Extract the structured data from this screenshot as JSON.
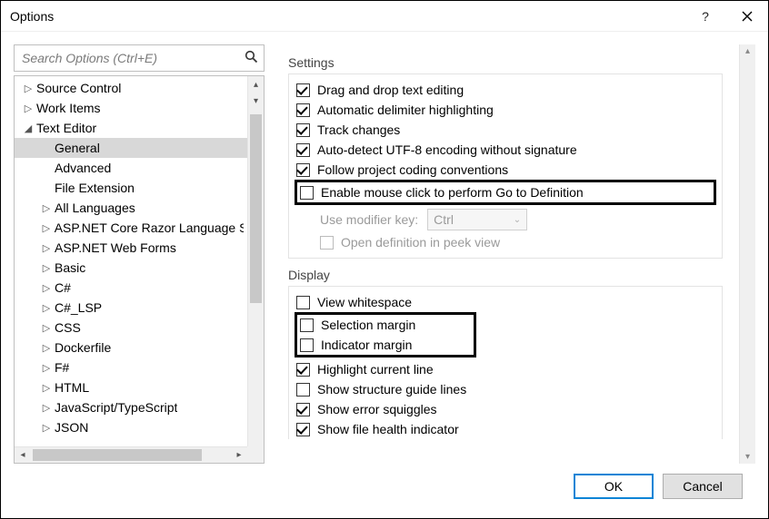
{
  "window": {
    "title": "Options"
  },
  "search": {
    "placeholder": "Search Options (Ctrl+E)"
  },
  "tree": {
    "items": [
      {
        "label": "Source Control",
        "arrow": "▷",
        "indent": 1,
        "selected": false
      },
      {
        "label": "Work Items",
        "arrow": "▷",
        "indent": 1,
        "selected": false
      },
      {
        "label": "Text Editor",
        "arrow": "◢",
        "indent": 1,
        "selected": false
      },
      {
        "label": "General",
        "arrow": "",
        "indent": 2,
        "selected": true
      },
      {
        "label": "Advanced",
        "arrow": "",
        "indent": 2,
        "selected": false
      },
      {
        "label": "File Extension",
        "arrow": "",
        "indent": 2,
        "selected": false
      },
      {
        "label": "All Languages",
        "arrow": "▷",
        "indent": 2,
        "selected": false
      },
      {
        "label": "ASP.NET Core Razor Language S",
        "arrow": "▷",
        "indent": 2,
        "selected": false
      },
      {
        "label": "ASP.NET Web Forms",
        "arrow": "▷",
        "indent": 2,
        "selected": false
      },
      {
        "label": "Basic",
        "arrow": "▷",
        "indent": 2,
        "selected": false
      },
      {
        "label": "C#",
        "arrow": "▷",
        "indent": 2,
        "selected": false
      },
      {
        "label": "C#_LSP",
        "arrow": "▷",
        "indent": 2,
        "selected": false
      },
      {
        "label": "CSS",
        "arrow": "▷",
        "indent": 2,
        "selected": false
      },
      {
        "label": "Dockerfile",
        "arrow": "▷",
        "indent": 2,
        "selected": false
      },
      {
        "label": "F#",
        "arrow": "▷",
        "indent": 2,
        "selected": false
      },
      {
        "label": "HTML",
        "arrow": "▷",
        "indent": 2,
        "selected": false
      },
      {
        "label": "JavaScript/TypeScript",
        "arrow": "▷",
        "indent": 2,
        "selected": false
      },
      {
        "label": "JSON",
        "arrow": "▷",
        "indent": 2,
        "selected": false
      }
    ]
  },
  "settings": {
    "title": "Settings",
    "items": [
      {
        "label": "Drag and drop text editing",
        "checked": true,
        "disabled": false,
        "highlight": false
      },
      {
        "label": "Automatic delimiter highlighting",
        "checked": true,
        "disabled": false,
        "highlight": false
      },
      {
        "label": "Track changes",
        "checked": true,
        "disabled": false,
        "highlight": false
      },
      {
        "label": "Auto-detect UTF-8 encoding without signature",
        "checked": true,
        "disabled": false,
        "highlight": false
      },
      {
        "label": "Follow project coding conventions",
        "checked": true,
        "disabled": false,
        "highlight": false
      },
      {
        "label": "Enable mouse click to perform Go to Definition",
        "checked": false,
        "disabled": false,
        "highlight": true
      }
    ],
    "modifier": {
      "label": "Use modifier key:",
      "value": "Ctrl"
    },
    "peek": {
      "label": "Open definition in peek view",
      "checked": false,
      "disabled": true
    }
  },
  "display": {
    "title": "Display",
    "items_pre": [
      {
        "label": "View whitespace",
        "checked": false
      }
    ],
    "items_hl": [
      {
        "label": "Selection margin",
        "checked": false
      },
      {
        "label": "Indicator margin",
        "checked": false
      }
    ],
    "items_post": [
      {
        "label": "Highlight current line",
        "checked": true
      },
      {
        "label": "Show structure guide lines",
        "checked": false
      },
      {
        "label": "Show error squiggles",
        "checked": true
      },
      {
        "label": "Show file health indicator",
        "checked": true
      }
    ]
  },
  "buttons": {
    "ok": "OK",
    "cancel": "Cancel"
  }
}
